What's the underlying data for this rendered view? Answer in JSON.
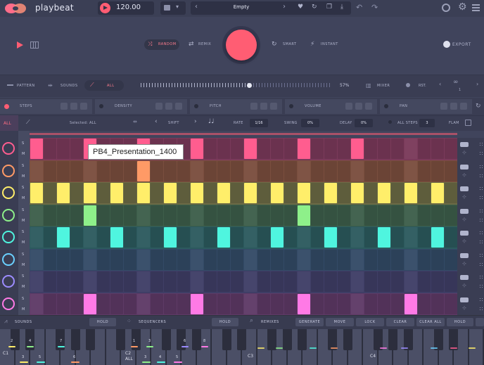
{
  "app": {
    "logo_text": "playbeat",
    "bpm": "120.00",
    "preset_name": "Empty"
  },
  "transport": {
    "random_label": "RANDOM",
    "remix_label": "REMIX",
    "smart_label": "SMART",
    "instant_label": "INSTANT",
    "export_label": "EXPORT"
  },
  "modebar": {
    "pattern_label": "PATTERN",
    "sounds_label": "SOUNDS",
    "all_label": "ALL",
    "percent": "57%",
    "mixer_label": "MIXER",
    "rst_label": "RST.",
    "counter": "1"
  },
  "lanes": {
    "steps_label": "STEPS",
    "density_label": "DENSITY",
    "pitch_label": "PITCH",
    "volume_label": "VOLUME",
    "pan_label": "PAN"
  },
  "controls": {
    "all_tab": "ALL",
    "selected_label": "Selected: ALL",
    "shift_label": "SHIFT",
    "note_icon": "♩♩",
    "rate_label": "RATE",
    "rate_value": "1/16",
    "swing_label": "SWING",
    "swing_value": "0%",
    "delay_label": "DELAY",
    "delay_value": "0%",
    "all_steps_label": "ALL STEPS",
    "all_steps_value": "3",
    "flam_label": "FLAM"
  },
  "grid": {
    "sm_labels": [
      "S",
      "M"
    ],
    "tracks": [
      {
        "name": "kick",
        "icon": "kick-drum-icon",
        "color": "#ff5d8f",
        "dim": "#7a3a5a",
        "steps": [
          0,
          4,
          8,
          12,
          16,
          20,
          24
        ]
      },
      {
        "name": "snare",
        "icon": "snare-icon",
        "color": "#ff9a66",
        "dim": "#7a4e3e",
        "steps": [
          8
        ]
      },
      {
        "name": "hat",
        "icon": "hihat-icon",
        "color": "#ffee6a",
        "dim": "#6b6a45",
        "steps": [
          0,
          2,
          4,
          6,
          8,
          10,
          12,
          14,
          16,
          18,
          20,
          22,
          24,
          26,
          28,
          30
        ]
      },
      {
        "name": "open-hat",
        "icon": "cymbal-icon",
        "color": "#8ef08a",
        "dim": "#3d5e4a",
        "steps": [
          4,
          20
        ]
      },
      {
        "name": "perc",
        "icon": "shaker-icon",
        "color": "#4ff5df",
        "dim": "#2c5a5e",
        "steps": [
          2,
          6,
          10,
          14,
          18,
          22,
          26,
          30
        ]
      },
      {
        "name": "tom",
        "icon": "tom-icon",
        "color": "#6ad0ff",
        "dim": "#334a66",
        "steps": []
      },
      {
        "name": "fx",
        "icon": "wave-icon",
        "color": "#9c8cff",
        "dim": "#3f3e66",
        "steps": []
      },
      {
        "name": "clap",
        "icon": "burst-icon",
        "color": "#ff7ae6",
        "dim": "#5e3a66",
        "steps": [
          4,
          12,
          20,
          28
        ]
      }
    ],
    "tooltip": "PB4_Presentation_1400"
  },
  "bottom": {
    "sounds_label": "SOUNDS",
    "hold1": "HOLD",
    "sequencers_label": "SEQUENCERS",
    "hold2": "HOLD",
    "remixes_label": "REMIXES",
    "generate": "GENERATE",
    "move": "MOVE",
    "lock": "LOCK",
    "clear": "CLEAR",
    "clear_all": "CLEAR ALL",
    "hold3": "HOLD"
  },
  "keyboard": {
    "octave_c1": "C1",
    "octave_c2": "C2",
    "octave_c2_sub": "ALL",
    "octave_c3": "C3",
    "octave_c4": "C4",
    "numbers": [
      "1",
      "2",
      "3",
      "4",
      "5",
      "6",
      "7",
      "8"
    ]
  }
}
